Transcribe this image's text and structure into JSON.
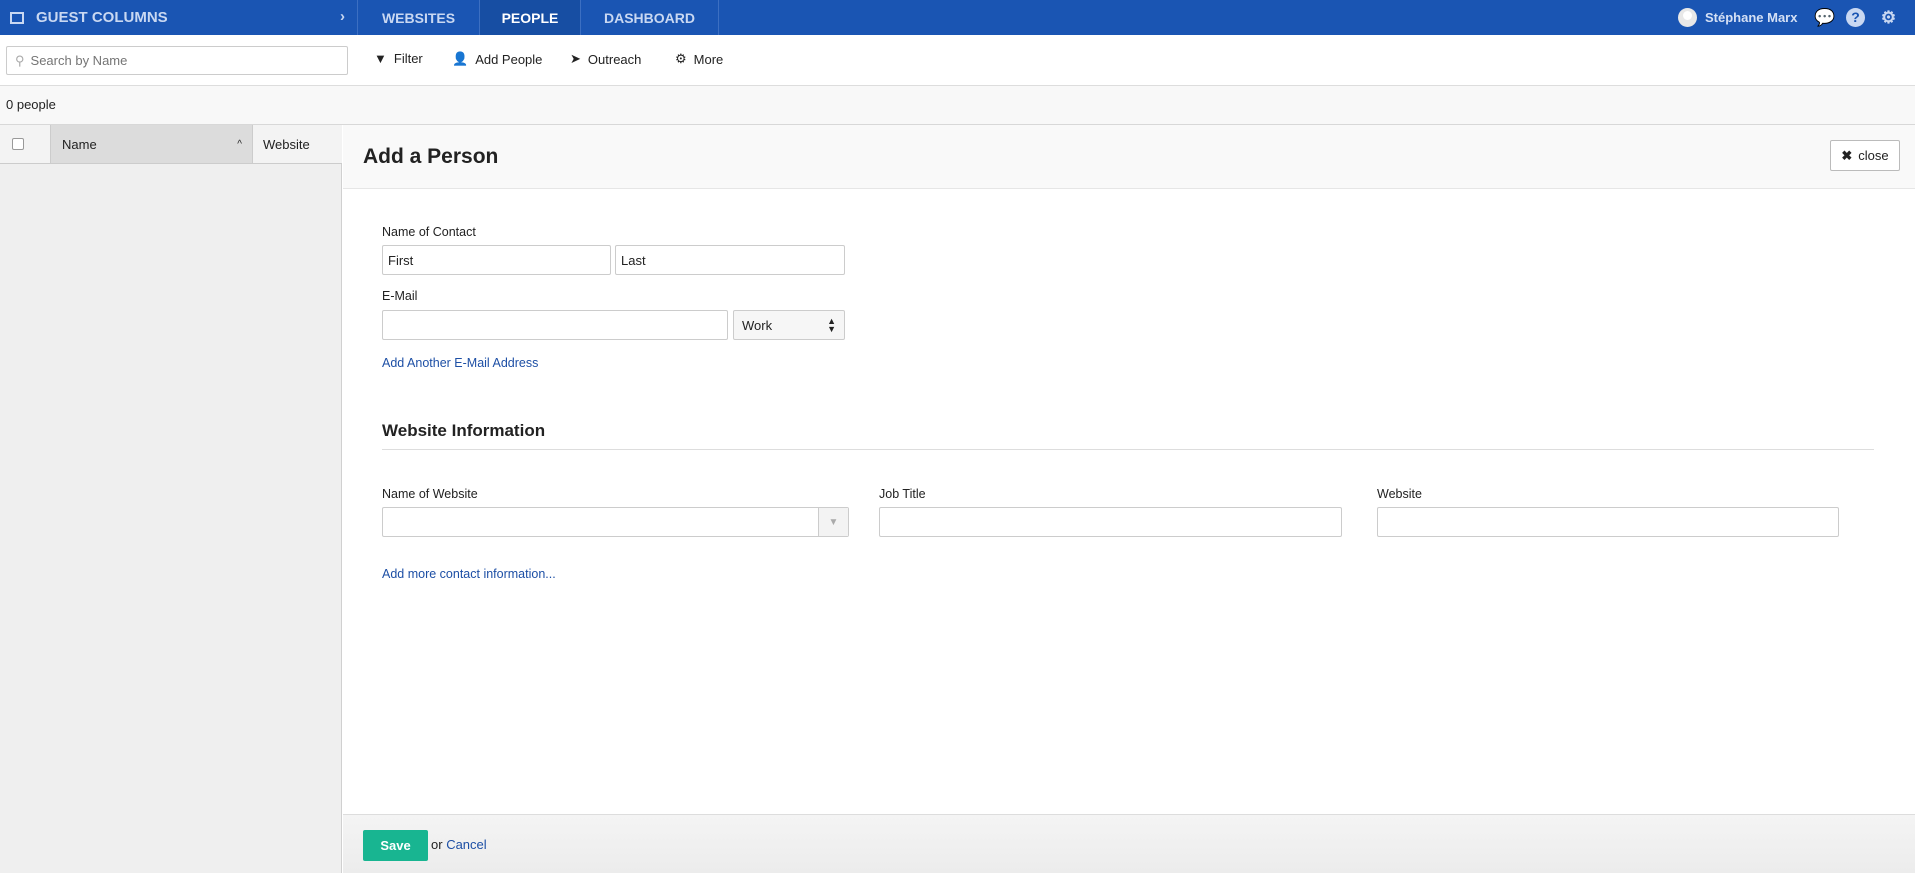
{
  "topbar": {
    "brand": "GUEST COLUMNS",
    "tabs": [
      {
        "label": "WEBSITES"
      },
      {
        "label": "PEOPLE",
        "active": true
      },
      {
        "label": "DASHBOARD"
      }
    ],
    "user_name": "Stéphane Marx",
    "icons": [
      "chat-icon",
      "help-icon",
      "gear-icon"
    ],
    "color": "#1a55b3"
  },
  "toolbar": {
    "search_placeholder": "Search by Name",
    "filter": "Filter",
    "add_people": "Add People",
    "outreach": "Outreach",
    "more": "More"
  },
  "list": {
    "count": "0 people",
    "columns": [
      "Name",
      "Website"
    ]
  },
  "panel": {
    "title": "Add a Person",
    "close": "close",
    "contact": {
      "label": "Name of Contact",
      "first_placeholder": "First",
      "last_placeholder": "Last"
    },
    "email": {
      "label": "E-Mail",
      "value": "",
      "type": "Work",
      "add_link": "Add Another E-Mail Address"
    },
    "website_section": {
      "title": "Website Information",
      "name_label": "Name of Website",
      "job_label": "Job Title",
      "website_label": "Website",
      "more_link": "Add more contact information..."
    }
  },
  "footer": {
    "save": "Save",
    "or": "or",
    "cancel": "Cancel",
    "save_color": "#18b591"
  }
}
